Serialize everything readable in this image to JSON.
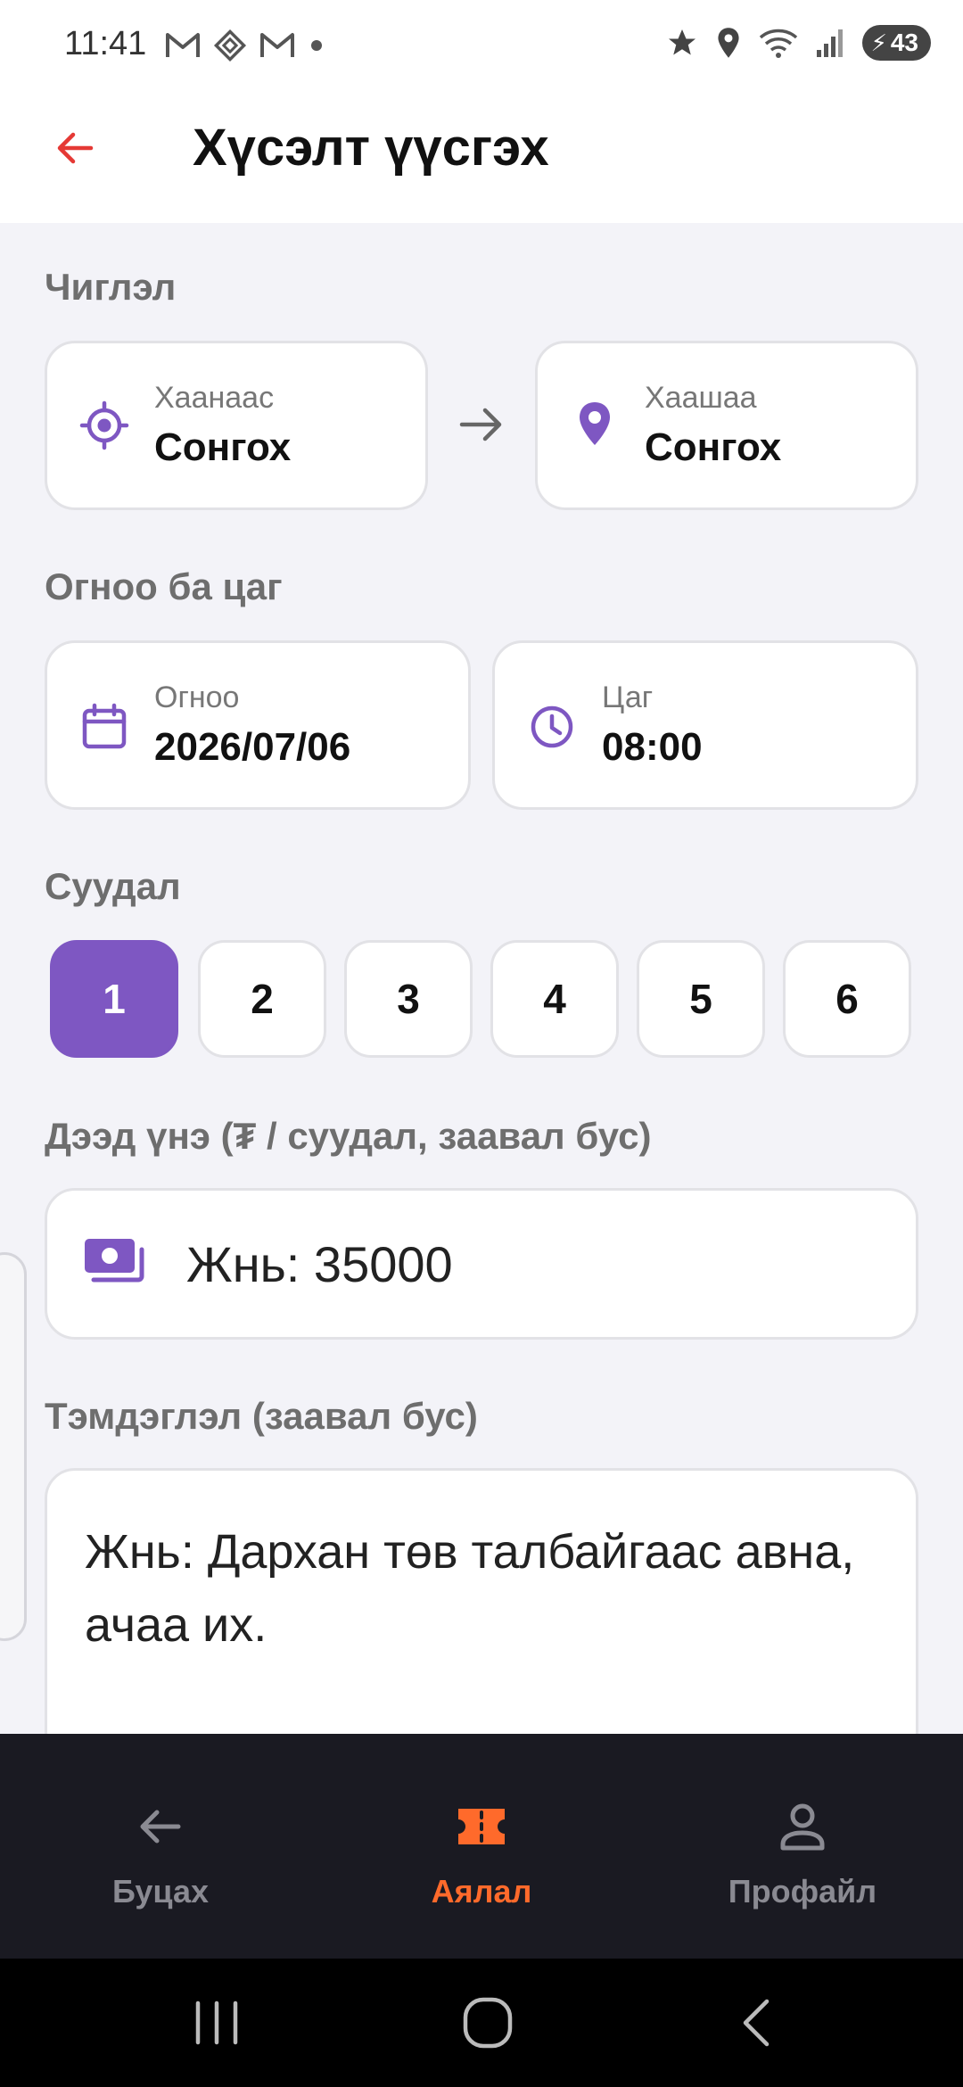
{
  "status_bar": {
    "time": "11:41",
    "left_icons": [
      "gmail-icon",
      "maps-diamond-icon",
      "gmail-icon",
      "dot-icon"
    ],
    "right_icons": [
      "star-icon",
      "location-icon",
      "wifi-icon",
      "signal-icon"
    ],
    "battery_level": "43"
  },
  "header": {
    "title": "Хүсэлт үүсгэх"
  },
  "route": {
    "label": "Чиглэл",
    "from": {
      "caption": "Хаанаас",
      "value": "Сонгох"
    },
    "to": {
      "caption": "Хаашаа",
      "value": "Сонгох"
    }
  },
  "datetime": {
    "label": "Огноо ба цаг",
    "date": {
      "caption": "Огноо",
      "value": "2026/07/06"
    },
    "time": {
      "caption": "Цаг",
      "value": "08:00"
    }
  },
  "seats": {
    "label": "Суудал",
    "options": [
      "1",
      "2",
      "3",
      "4",
      "5",
      "6"
    ],
    "selected": "1"
  },
  "price": {
    "label": "Дээд үнэ (₮ / суудал, заавал бус)",
    "value": "Жнь: 35000"
  },
  "note": {
    "label": "Тэмдэглэл (заавал бус)",
    "value": "Жнь: Дархан төв талбайгаас авна, ачаа их."
  },
  "bottom_nav": {
    "items": [
      {
        "label": "Буцах",
        "icon": "arrow-left-icon"
      },
      {
        "label": "Аялал",
        "icon": "ticket-icon"
      },
      {
        "label": "Профайл",
        "icon": "person-icon"
      }
    ],
    "active": "Аялал"
  },
  "colors": {
    "accent_purple": "#7e57c2",
    "active_orange": "#ff6a2b",
    "back_red": "#e53935",
    "nav_background": "#1a1a22"
  }
}
